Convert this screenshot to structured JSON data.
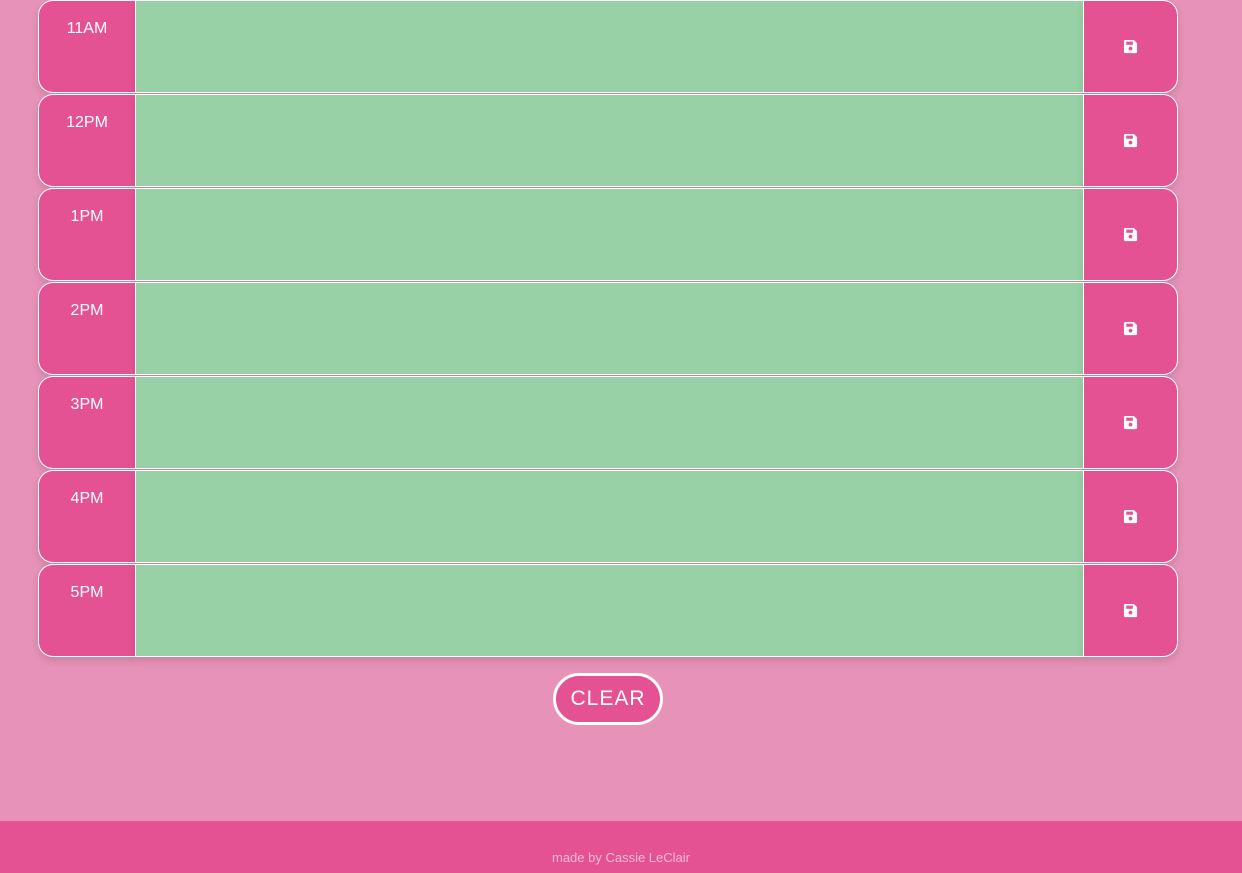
{
  "schedule": {
    "rows": [
      {
        "hour": "11AM",
        "text": "",
        "save_icon": "floppy-disk-icon"
      },
      {
        "hour": "12PM",
        "text": "",
        "save_icon": "floppy-disk-icon"
      },
      {
        "hour": "1PM",
        "text": "",
        "save_icon": "floppy-disk-icon"
      },
      {
        "hour": "2PM",
        "text": "",
        "save_icon": "floppy-disk-icon"
      },
      {
        "hour": "3PM",
        "text": "",
        "save_icon": "floppy-disk-icon"
      },
      {
        "hour": "4PM",
        "text": "",
        "save_icon": "floppy-disk-icon"
      },
      {
        "hour": "5PM",
        "text": "",
        "save_icon": "floppy-disk-icon"
      }
    ]
  },
  "clear_button": {
    "label": "CLEAR"
  },
  "footer": {
    "credit": "made by Cassie LeClair"
  },
  "colors": {
    "background": "#e792b8",
    "accent_pink": "#e55294",
    "future_row_green": "#98d1a6",
    "text_white": "#ffffff"
  }
}
